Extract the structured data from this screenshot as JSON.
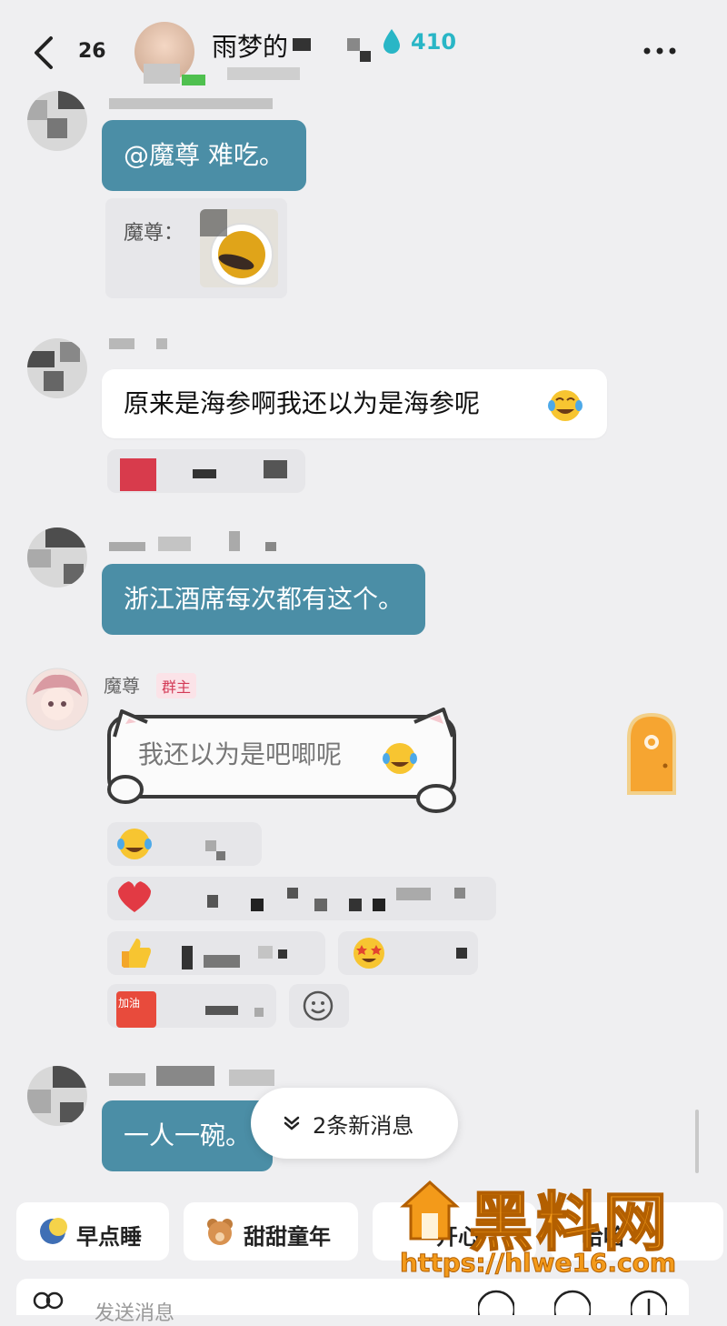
{
  "header": {
    "unread_count": "26",
    "title": "雨梦的",
    "score": "410"
  },
  "messages": {
    "m1_text": "@魔尊 难吃。",
    "m1_quote_name": "魔尊：",
    "m2_text": "原来是海参啊我还以为是海参呢",
    "m3_text": "浙江酒席每次都有这个。",
    "m4_sender": "魔尊",
    "m4_badge": "群主",
    "m4_text": "我还以为是吧唧呢",
    "m5_text": "一人一碗。",
    "reaction_tag": "加油"
  },
  "new_messages": {
    "label": "2条新消息"
  },
  "quick_chips": [
    {
      "label": "早点睡"
    },
    {
      "label": "甜甜童年"
    },
    {
      "label": "开心"
    },
    {
      "label": "哈哈"
    }
  ],
  "input": {
    "placeholder": "发送消息"
  },
  "watermark": {
    "text": "黑料网",
    "url": "https://hlwe16.com"
  },
  "colors": {
    "bubble_blue": "#4b8ea6",
    "score": "#29b6c6",
    "owner_badge": "#d33b57",
    "watermark": "#f39a1a"
  }
}
